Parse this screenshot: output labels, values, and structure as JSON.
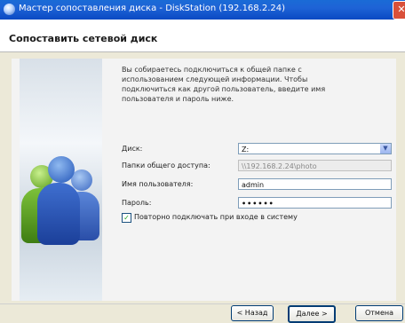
{
  "window": {
    "title": "Мастер сопоставления диска - DiskStation (192.168.2.24)",
    "close_symbol": "✕"
  },
  "header": {
    "title": "Сопоставить сетевой диск"
  },
  "intro_text": "Вы собираетесь подключиться к общей папке с использованием следующей информации. Чтобы подключиться как другой пользователь, введите имя пользователя и пароль ниже.",
  "form": {
    "disk_label": "Диск:",
    "disk_value": "Z:",
    "share_label": "Папки общего доступа:",
    "share_value": "\\\\192.168.2.24\\photo",
    "user_label": "Имя пользователя:",
    "user_value": "admin",
    "password_label": "Пароль:",
    "password_value": "••••••",
    "reconnect_checked": true,
    "reconnect_label": "Повторно подключать при входе в систему",
    "select_arrow_icon": "chevron-down-icon"
  },
  "buttons": {
    "back": "< Назад",
    "next": "Далее >",
    "cancel": "Отмена"
  },
  "icons": {
    "app": "network-drive-icon",
    "sidebar_art": "users-group-illustration"
  }
}
